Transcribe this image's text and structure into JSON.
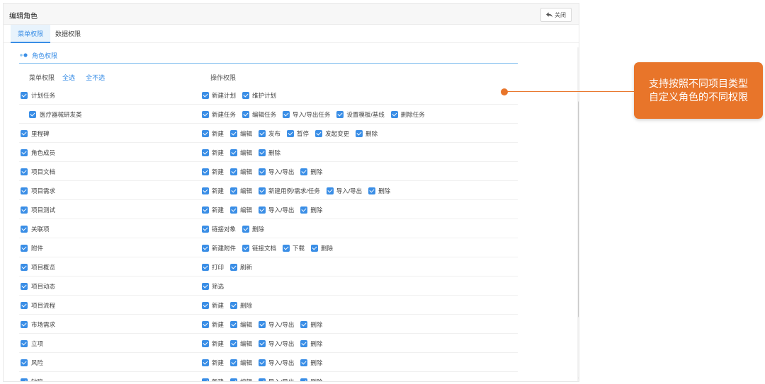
{
  "header": {
    "title": "编辑角色",
    "close_label": "关闭"
  },
  "tabs": [
    {
      "label": "菜单权限",
      "active": true
    },
    {
      "label": "数据权限",
      "active": false
    }
  ],
  "section": {
    "label": "角色权限"
  },
  "columns": {
    "menu": "菜单权限",
    "select_all": "全选",
    "select_none": "全不选",
    "ops": "操作权限"
  },
  "accent_color": "#3a8ee6",
  "callout": {
    "line1": "支持按照不同项目类型",
    "line2": "自定义角色的不同权限",
    "color": "#e8752a"
  },
  "rows": [
    {
      "label": "计划任务",
      "checked": true,
      "indent": false,
      "ops": [
        "新建计划",
        "维护计划"
      ]
    },
    {
      "label": "医疗器械研发类",
      "checked": true,
      "indent": true,
      "ops": [
        "新建任务",
        "编辑任务",
        "导入/导出任务",
        "设置模板/基线",
        "删除任务"
      ]
    },
    {
      "label": "里程碑",
      "checked": true,
      "indent": false,
      "ops": [
        "新建",
        "编辑",
        "发布",
        "暂停",
        "发起变更",
        "删除"
      ]
    },
    {
      "label": "角色成员",
      "checked": true,
      "indent": false,
      "ops": [
        "新建",
        "编辑",
        "删除"
      ]
    },
    {
      "label": "项目文档",
      "checked": true,
      "indent": false,
      "ops": [
        "新建",
        "编辑",
        "导入/导出",
        "删除"
      ]
    },
    {
      "label": "项目需求",
      "checked": true,
      "indent": false,
      "ops": [
        "新建",
        "编辑",
        "新建用例/需求/任务",
        "导入/导出",
        "删除"
      ]
    },
    {
      "label": "项目测试",
      "checked": true,
      "indent": false,
      "ops": [
        "新建",
        "编辑",
        "导入/导出",
        "删除"
      ]
    },
    {
      "label": "关联项",
      "checked": true,
      "indent": false,
      "ops": [
        "链接对象",
        "删除"
      ]
    },
    {
      "label": "附件",
      "checked": true,
      "indent": false,
      "ops": [
        "新建附件",
        "链接文档",
        "下载",
        "删除"
      ]
    },
    {
      "label": "项目概览",
      "checked": true,
      "indent": false,
      "ops": [
        "打印",
        "刷新"
      ]
    },
    {
      "label": "项目动态",
      "checked": true,
      "indent": false,
      "ops": [
        "筛选"
      ]
    },
    {
      "label": "项目流程",
      "checked": true,
      "indent": false,
      "ops": [
        "新建",
        "删除"
      ]
    },
    {
      "label": "市场需求",
      "checked": true,
      "indent": false,
      "ops": [
        "新建",
        "编辑",
        "导入/导出",
        "删除"
      ]
    },
    {
      "label": "立项",
      "checked": true,
      "indent": false,
      "ops": [
        "新建",
        "编辑",
        "导入/导出",
        "删除"
      ]
    },
    {
      "label": "风险",
      "checked": true,
      "indent": false,
      "ops": [
        "新建",
        "编辑",
        "导入/导出",
        "删除"
      ]
    },
    {
      "label": "缺陷",
      "checked": true,
      "indent": false,
      "ops": [
        "新建",
        "编辑",
        "导入/导出",
        "删除"
      ]
    }
  ]
}
